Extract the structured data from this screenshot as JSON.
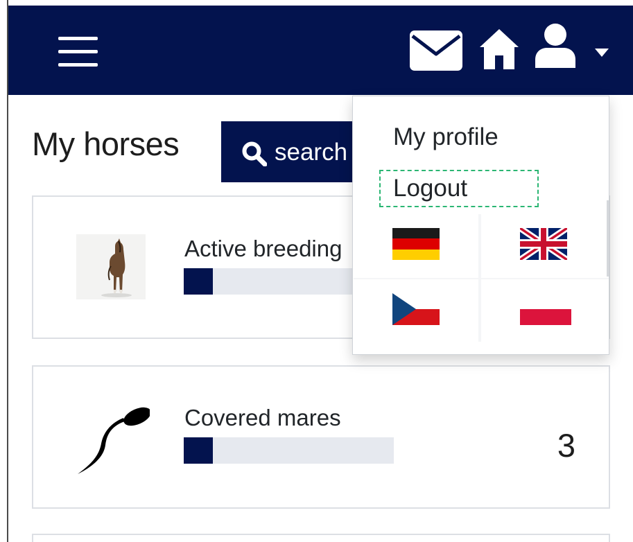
{
  "app": {
    "colors": {
      "brand": "#03134e",
      "progress_track": "#e6e9ef",
      "focus_outline": "#2bb673"
    }
  },
  "navbar": {
    "icons": [
      "hamburger-menu-icon",
      "envelope-icon",
      "home-icon",
      "user-icon",
      "caret-down-icon"
    ]
  },
  "main": {
    "title": "My horses",
    "search_button": {
      "label": "search",
      "icon": "search-icon"
    },
    "cards": [
      {
        "label": "Active breeding",
        "count": "",
        "progress": 0.14,
        "image": "horse-photo"
      },
      {
        "label": "Covered mares",
        "count": "3",
        "progress": 0.14,
        "image": "sperm-icon"
      }
    ]
  },
  "user_menu": {
    "items": [
      {
        "label": "My profile"
      },
      {
        "label": "Logout"
      }
    ],
    "languages": [
      {
        "code": "de",
        "icon": "germany-flag-icon"
      },
      {
        "code": "en",
        "icon": "united-kingdom-flag-icon"
      },
      {
        "code": "cs",
        "icon": "czech-flag-icon"
      },
      {
        "code": "pl",
        "icon": "poland-flag-icon"
      }
    ]
  }
}
